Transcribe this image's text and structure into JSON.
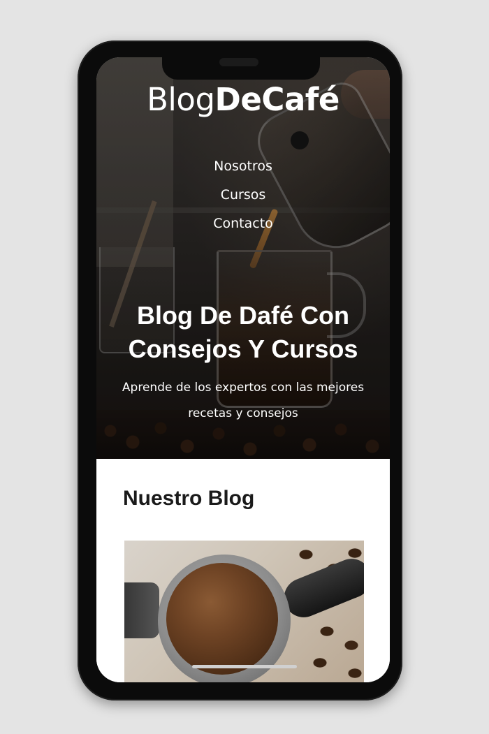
{
  "logo": {
    "light": "Blog",
    "bold": "DeCafé"
  },
  "nav": {
    "items": [
      "Nosotros",
      "Cursos",
      "Contacto"
    ]
  },
  "hero": {
    "title_line1": "Blog De Dafé Con",
    "title_line2": "Consejos Y Cursos",
    "subtitle_line1": "Aprende de los expertos con las mejores",
    "subtitle_line2": "recetas y consejos"
  },
  "blog": {
    "heading": "Nuestro Blog"
  },
  "colors": {
    "page_bg": "#e4e4e4",
    "phone_frame": "#0b0b0b",
    "hero_text": "#ffffff",
    "heading_text": "#1a1a1a"
  },
  "icons": [
    "notch",
    "speaker",
    "home-indicator"
  ]
}
